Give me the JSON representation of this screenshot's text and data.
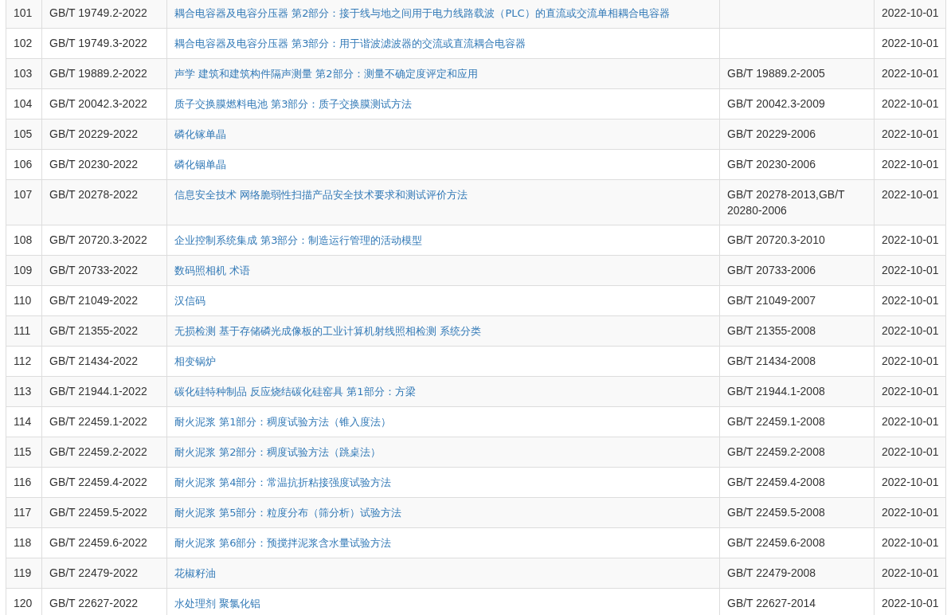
{
  "table": {
    "rows": [
      {
        "number": "101",
        "code": "GB/T 19749.2-2022",
        "title": "耦合电容器及电容分压器 第2部分：接于线与地之间用于电力线路载波（PLC）的直流或交流单相耦合电容器",
        "date": "2022-10-01"
      },
      {
        "number": "102",
        "code": "GB/T 19749.3-2022",
        "title": "耦合电容器及电容分压器 第3部分：用于谐波滤波器的交流或直流耦合电容器",
        "date": "2022-10-01"
      },
      {
        "number": "103",
        "code": "GB/T 19889.2-2022",
        "title": "声学 建筑和建筑构件隔声测量 第2部分：测量不确定度评定和应用",
        "replaces": "GB/T 19889.2-2005",
        "date": "2022-10-01"
      },
      {
        "number": "104",
        "code": "GB/T 20042.3-2022",
        "title": "质子交换膜燃料电池 第3部分：质子交换膜测试方法",
        "replaces": "GB/T 20042.3-2009",
        "date": "2022-10-01"
      },
      {
        "number": "105",
        "code": "GB/T 20229-2022",
        "title": "磷化镓单晶",
        "replaces": "GB/T 20229-2006",
        "date": "2022-10-01"
      },
      {
        "number": "106",
        "code": "GB/T 20230-2022",
        "title": "磷化铟单晶",
        "replaces": "GB/T 20230-2006",
        "date": "2022-10-01"
      },
      {
        "number": "107",
        "code": "GB/T 20278-2022",
        "title": "信息安全技术 网络脆弱性扫描产品安全技术要求和测试评价方法",
        "replaces": "GB/T 20278-2013,GB/T 20280-2006",
        "date": "2022-10-01"
      },
      {
        "number": "108",
        "code": "GB/T 20720.3-2022",
        "title": "企业控制系统集成 第3部分：制造运行管理的活动模型",
        "replaces": "GB/T 20720.3-2010",
        "date": "2022-10-01"
      },
      {
        "number": "109",
        "code": "GB/T 20733-2022",
        "title": "数码照相机 术语",
        "replaces": "GB/T 20733-2006",
        "date": "2022-10-01"
      },
      {
        "number": "110",
        "code": "GB/T 21049-2022",
        "title": "汉信码",
        "replaces": "GB/T 21049-2007",
        "date": "2022-10-01"
      },
      {
        "number": "111",
        "code": "GB/T 21355-2022",
        "title": "无损检测 基于存储磷光成像板的工业计算机射线照相检测 系统分类",
        "replaces": "GB/T 21355-2008",
        "date": "2022-10-01"
      },
      {
        "number": "112",
        "code": "GB/T 21434-2022",
        "title": "相变锅炉",
        "replaces": "GB/T 21434-2008",
        "date": "2022-10-01"
      },
      {
        "number": "113",
        "code": "GB/T 21944.1-2022",
        "title": "碳化硅特种制品 反应烧结碳化硅窑具 第1部分：方梁",
        "replaces": "GB/T 21944.1-2008",
        "date": "2022-10-01"
      },
      {
        "number": "114",
        "code": "GB/T 22459.1-2022",
        "title": "耐火泥浆 第1部分：稠度试验方法（锥入度法）",
        "replaces": "GB/T 22459.1-2008",
        "date": "2022-10-01"
      },
      {
        "number": "115",
        "code": "GB/T 22459.2-2022",
        "title": "耐火泥浆 第2部分：稠度试验方法（跳桌法）",
        "replaces": "GB/T 22459.2-2008",
        "date": "2022-10-01"
      },
      {
        "number": "116",
        "code": "GB/T 22459.4-2022",
        "title": "耐火泥浆 第4部分：常温抗折粘接强度试验方法",
        "replaces": "GB/T 22459.4-2008",
        "date": "2022-10-01"
      },
      {
        "number": "117",
        "code": "GB/T 22459.5-2022",
        "title": "耐火泥浆 第5部分：粒度分布（筛分析）试验方法",
        "replaces": "GB/T 22459.5-2008",
        "date": "2022-10-01"
      },
      {
        "number": "118",
        "code": "GB/T 22459.6-2022",
        "title": "耐火泥浆 第6部分：预搅拌泥浆含水量试验方法",
        "replaces": "GB/T 22459.6-2008",
        "date": "2022-10-01"
      },
      {
        "number": "119",
        "code": "GB/T 22479-2022",
        "title": "花椒籽油",
        "replaces": "GB/T 22479-2008",
        "date": "2022-10-01"
      },
      {
        "number": "120",
        "code": "GB/T 22627-2022",
        "title": "水处理剂 聚氯化铝",
        "replaces": "GB/T 22627-2014",
        "date": "2022-10-01"
      }
    ]
  }
}
